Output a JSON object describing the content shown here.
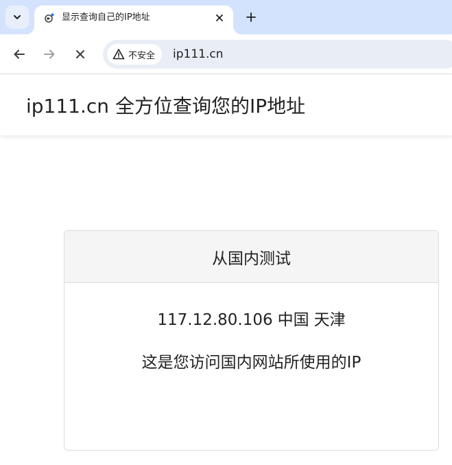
{
  "browser": {
    "tab": {
      "title": "显示查询自己的IP地址",
      "favicon": "loading-globe-icon"
    },
    "address_bar": {
      "security_label": "不安全",
      "url": "ip111.cn"
    },
    "icons": {
      "tab_search": "chevron-down-icon",
      "close_tab": "close-icon",
      "new_tab": "plus-icon",
      "back": "arrow-left-icon",
      "forward": "arrow-right-icon",
      "stop": "close-icon",
      "security": "warning-triangle-icon"
    },
    "colors": {
      "tabstrip": "#d3e3fd",
      "omnibox": "#e9eef6"
    }
  },
  "page": {
    "title": "ip111.cn 全方位查询您的IP地址",
    "card": {
      "heading": "从国内测试",
      "ip": "117.12.80.106",
      "country": "中国",
      "city": "天津",
      "note": "这是您访问国内网站所使用的IP"
    }
  }
}
